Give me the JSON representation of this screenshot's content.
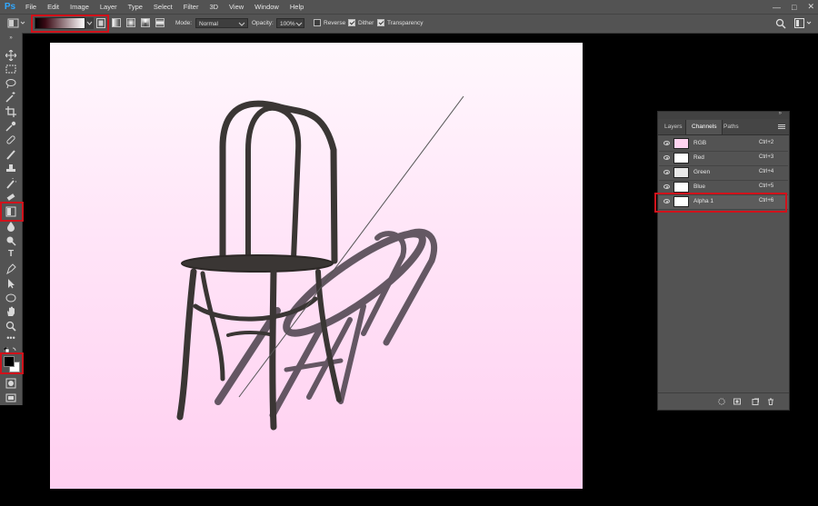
{
  "app": {
    "logo": "Ps"
  },
  "menu": [
    "File",
    "Edit",
    "Image",
    "Layer",
    "Type",
    "Select",
    "Filter",
    "3D",
    "View",
    "Window",
    "Help"
  ],
  "window_controls": {
    "minimize": "—",
    "maximize": "□",
    "close": "✕"
  },
  "options_bar": {
    "mode_label": "Mode:",
    "mode_value": "Normal",
    "opacity_label": "Opacity:",
    "opacity_value": "100%",
    "reverse_label": "Reverse",
    "reverse_checked": false,
    "dither_label": "Dither",
    "dither_checked": true,
    "transparency_label": "Transparency",
    "transparency_checked": true
  },
  "channels_panel": {
    "tabs": [
      "Layers",
      "Channels",
      "Paths"
    ],
    "active_tab": "Channels",
    "channels": [
      {
        "name": "RGB",
        "shortcut": "Ctrl+2"
      },
      {
        "name": "Red",
        "shortcut": "Ctrl+3"
      },
      {
        "name": "Green",
        "shortcut": "Ctrl+4"
      },
      {
        "name": "Blue",
        "shortcut": "Ctrl+5"
      },
      {
        "name": "Alpha 1",
        "shortcut": "Ctrl+6"
      }
    ]
  },
  "colors": {
    "highlight": "#d0121b",
    "ui_bg": "#535353",
    "canvas_top": "#fff8fd",
    "canvas_bottom": "#ffcff0"
  }
}
